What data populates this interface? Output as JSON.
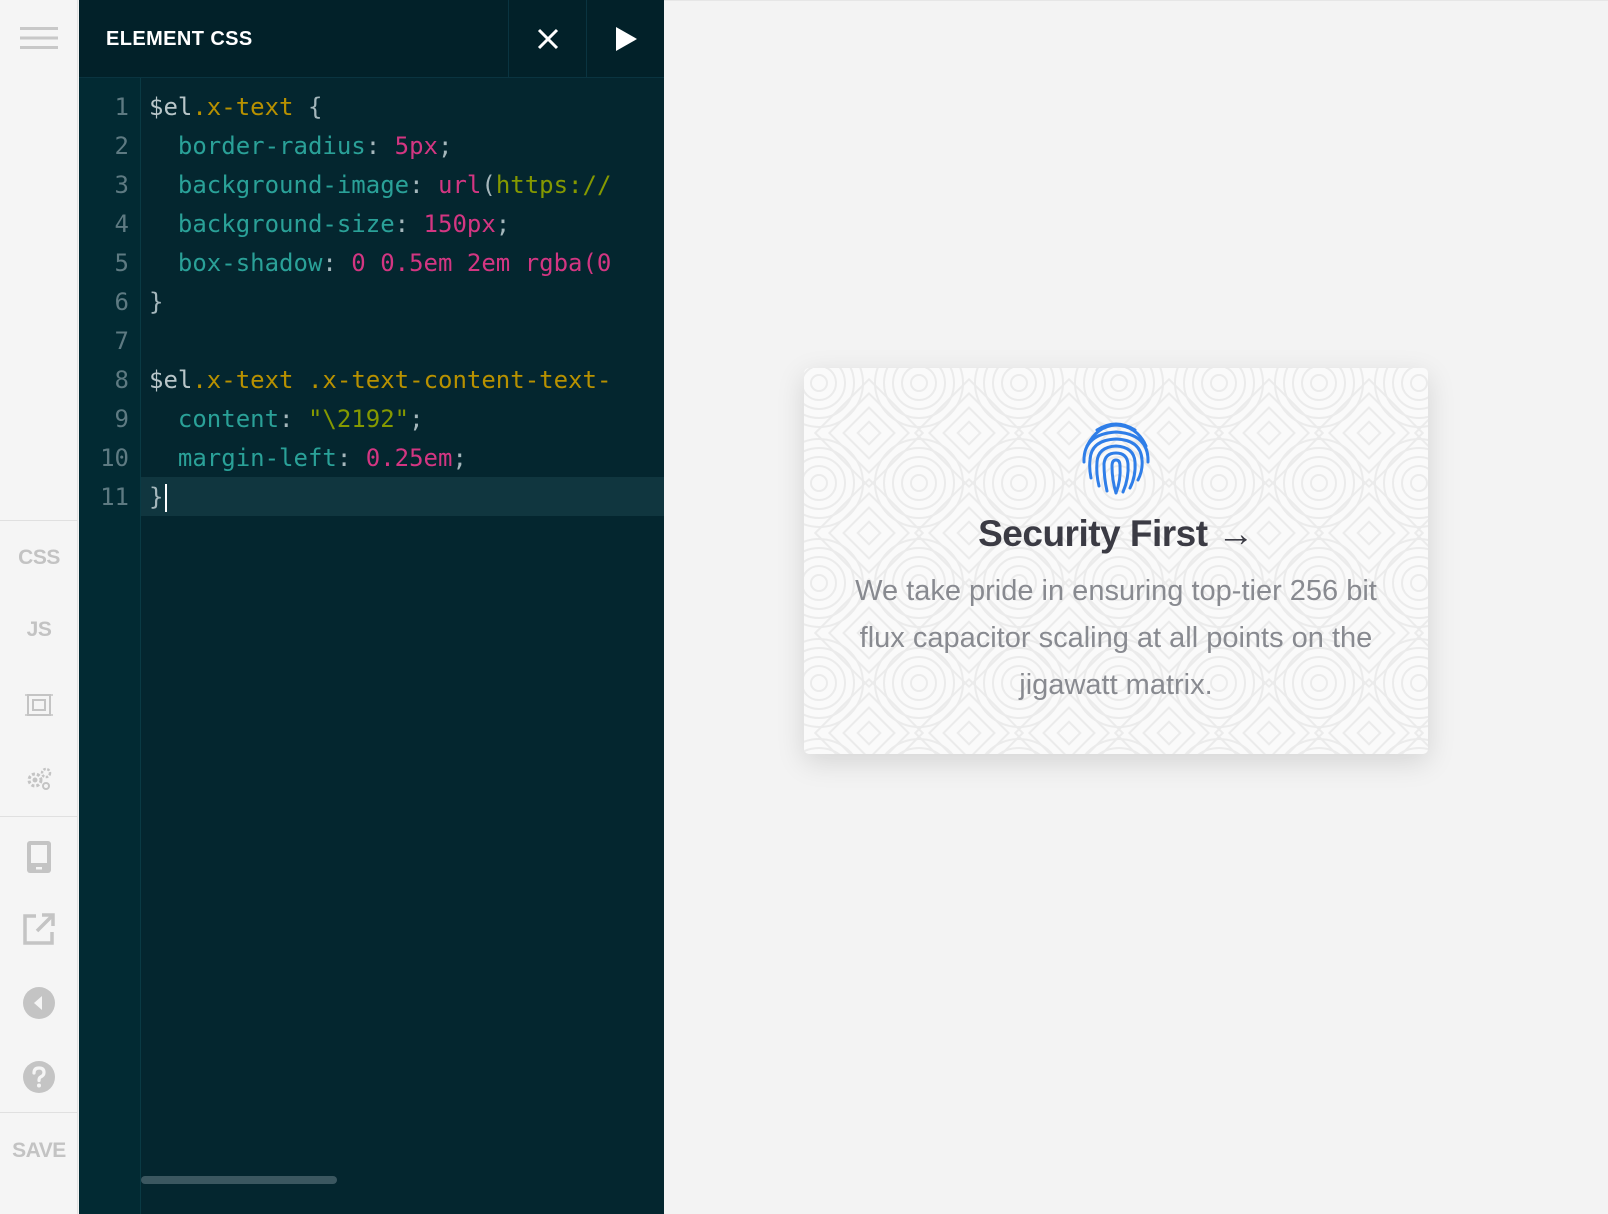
{
  "rail": {
    "css_label": "CSS",
    "js_label": "JS",
    "save_label": "SAVE"
  },
  "editor": {
    "title": "ELEMENT CSS",
    "line_numbers": [
      "1",
      "2",
      "3",
      "4",
      "5",
      "6",
      "7",
      "8",
      "9",
      "10",
      "11"
    ],
    "lines": [
      [
        {
          "t": "$el",
          "c": "sel"
        },
        {
          "t": ".x-text",
          "c": "cls"
        },
        {
          "t": " {",
          "c": "punc"
        }
      ],
      [
        {
          "t": "  border-radius",
          "c": "prop"
        },
        {
          "t": ": ",
          "c": "punc"
        },
        {
          "t": "5px",
          "c": "num"
        },
        {
          "t": ";",
          "c": "punc"
        }
      ],
      [
        {
          "t": "  background-image",
          "c": "prop"
        },
        {
          "t": ": ",
          "c": "punc"
        },
        {
          "t": "url",
          "c": "fn"
        },
        {
          "t": "(",
          "c": "punc"
        },
        {
          "t": "https://",
          "c": "str"
        }
      ],
      [
        {
          "t": "  background-size",
          "c": "prop"
        },
        {
          "t": ": ",
          "c": "punc"
        },
        {
          "t": "150px",
          "c": "num"
        },
        {
          "t": ";",
          "c": "punc"
        }
      ],
      [
        {
          "t": "  box-shadow",
          "c": "prop"
        },
        {
          "t": ": ",
          "c": "punc"
        },
        {
          "t": "0 0.5em 2em ",
          "c": "num"
        },
        {
          "t": "rgba",
          "c": "fn"
        },
        {
          "t": "(0",
          "c": "num"
        }
      ],
      [
        {
          "t": "}",
          "c": "punc"
        }
      ],
      [],
      [
        {
          "t": "$el",
          "c": "sel"
        },
        {
          "t": ".x-text",
          "c": "cls"
        },
        {
          "t": " ",
          "c": "punc"
        },
        {
          "t": ".x-text-content-text-",
          "c": "cls"
        }
      ],
      [
        {
          "t": "  content",
          "c": "prop"
        },
        {
          "t": ": ",
          "c": "punc"
        },
        {
          "t": "\"\\2192\"",
          "c": "str"
        },
        {
          "t": ";",
          "c": "punc"
        }
      ],
      [
        {
          "t": "  margin-left",
          "c": "prop"
        },
        {
          "t": ": ",
          "c": "punc"
        },
        {
          "t": "0.25em",
          "c": "num"
        },
        {
          "t": ";",
          "c": "punc"
        }
      ],
      [
        {
          "t": "}",
          "c": "punc"
        }
      ]
    ]
  },
  "card": {
    "title": "Security First →",
    "body": "We take pride in ensuring top-tier 256 bit flux capacitor scaling at all points on the jigawatt matrix."
  },
  "colors": {
    "editor_bg": "#04262f",
    "header_bg": "#022129",
    "fingerprint": "#2f7ee8"
  }
}
